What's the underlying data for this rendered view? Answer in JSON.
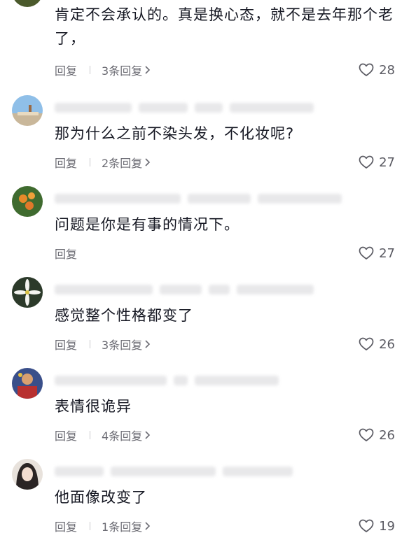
{
  "comments": [
    {
      "text": "肯定不会承认的。真是换心态，就不是去年那个老了，",
      "reply_label": "回复",
      "replies_label": "3条回复",
      "likes": "28"
    },
    {
      "text": "那为什么之前不染头发，不化妆呢?",
      "reply_label": "回复",
      "replies_label": "2条回复",
      "likes": "27"
    },
    {
      "text": "问题是你是有事的情况下。",
      "reply_label": "回复",
      "replies_label": "",
      "likes": "27"
    },
    {
      "text": "感觉整个性格都变了",
      "reply_label": "回复",
      "replies_label": "3条回复",
      "likes": "26"
    },
    {
      "text": "表情很诡异",
      "reply_label": "回复",
      "replies_label": "4条回复",
      "likes": "26"
    },
    {
      "text": "他面像改变了",
      "reply_label": "回复",
      "replies_label": "1条回复",
      "likes": "19"
    }
  ],
  "icons": {
    "like": "heart-outline-icon",
    "more_replies": "chevron-right-icon"
  },
  "colors": {
    "text": "#161823",
    "secondary": "#6b6b73",
    "separator": "#c8c8cc"
  }
}
